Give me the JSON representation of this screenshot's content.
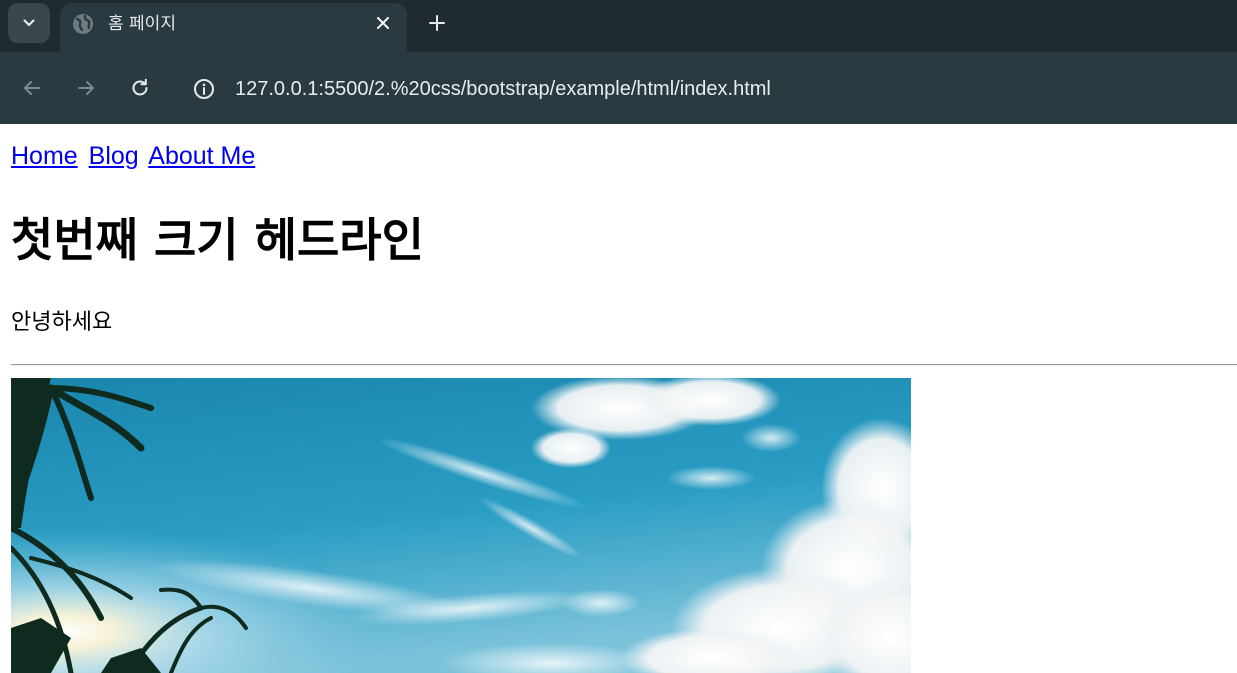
{
  "browser": {
    "tab": {
      "title": "홈 페이지"
    },
    "address_bar": {
      "url": "127.0.0.1:5500/2.%20css/bootstrap/example/html/index.html"
    }
  },
  "page": {
    "nav": {
      "links": [
        "Home",
        "Blog",
        "About Me"
      ]
    },
    "heading": "첫번째 크기 헤드라인",
    "paragraph": "안녕하세요",
    "image": {
      "subject": "sky with clouds and palm trees"
    }
  },
  "colors": {
    "tabstrip": "#1f2b31",
    "toolbar": "#2a3a41",
    "link": "#0000ee",
    "sky": "#1b8bb2"
  }
}
